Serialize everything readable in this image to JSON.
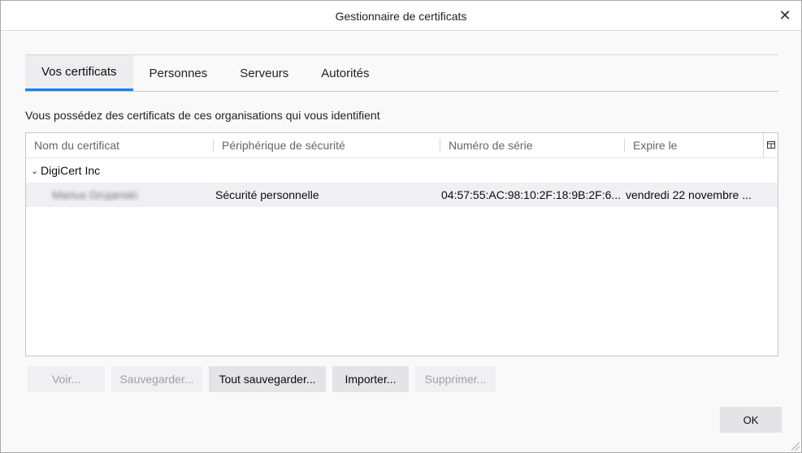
{
  "window": {
    "title": "Gestionnaire de certificats",
    "close_glyph": "✕"
  },
  "tabs": [
    {
      "label": "Vos certificats",
      "active": true
    },
    {
      "label": "Personnes",
      "active": false
    },
    {
      "label": "Serveurs",
      "active": false
    },
    {
      "label": "Autorités",
      "active": false
    }
  ],
  "description": "Vous possédez des certificats de ces organisations qui vous identifient",
  "table": {
    "columns": [
      "Nom du certificat",
      "Périphérique de sécurité",
      "Numéro de série",
      "Expire le"
    ],
    "groups": [
      {
        "name": "DigiCert Inc",
        "expanded": true,
        "rows": [
          {
            "name": "Marius Grujanski",
            "device": "Sécurité personnelle",
            "serial": "04:57:55:AC:98:10:2F:18:9B:2F:6...",
            "expires": "vendredi 22 novembre ..."
          }
        ]
      }
    ]
  },
  "buttons": {
    "view": "Voir...",
    "save": "Sauvegarder...",
    "save_all": "Tout sauvegarder...",
    "import": "Importer...",
    "delete": "Supprimer...",
    "ok": "OK"
  },
  "colors": {
    "accent": "#0a84ff"
  }
}
